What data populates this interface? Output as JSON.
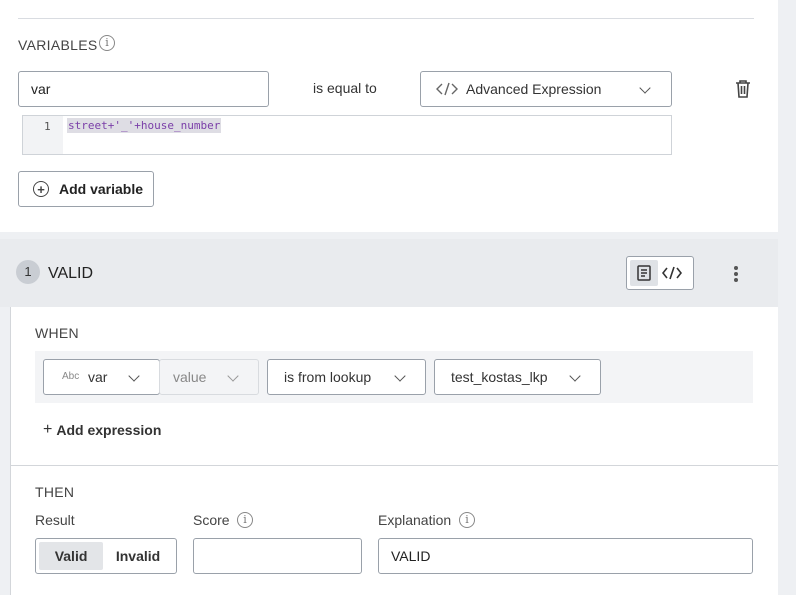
{
  "variables": {
    "title": "VARIABLES",
    "info_icon": "info-icon",
    "name_value": "var",
    "operator": "is equal to",
    "type_select": {
      "icon": "code-icon",
      "value": "Advanced Expression"
    },
    "delete_icon": "trash-icon",
    "editor": {
      "line_number": "1",
      "code": "street+'_'+house_number"
    },
    "add_button": "Add variable"
  },
  "rule": {
    "number": "1",
    "title": "VALID",
    "view_toggle": {
      "form_icon": "form-icon",
      "code_icon": "code-icon",
      "active": "form"
    },
    "menu_icon": "more-vertical-icon",
    "when": {
      "label": "WHEN",
      "condition": {
        "field_type_badge": "Abc",
        "field": "var",
        "property": "value",
        "operator": "is from lookup",
        "lookup": "test_kostas_lkp"
      },
      "add_expression": "Add expression"
    },
    "then": {
      "label": "THEN",
      "result_label": "Result",
      "result_options": [
        "Valid",
        "Invalid"
      ],
      "result_selected": "Valid",
      "score_label": "Score",
      "score_value": "",
      "explanation_label": "Explanation",
      "explanation_value": "VALID"
    }
  }
}
